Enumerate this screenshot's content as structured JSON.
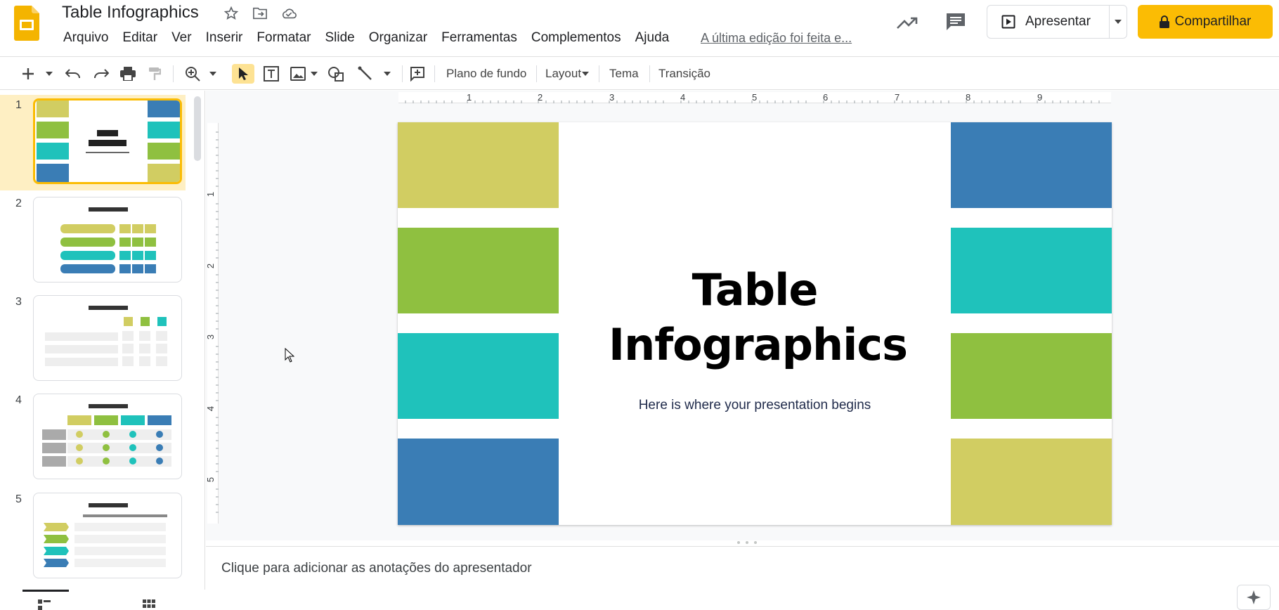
{
  "header": {
    "doc_title": "Table Infographics",
    "menu": [
      "Arquivo",
      "Editar",
      "Ver",
      "Inserir",
      "Formatar",
      "Slide",
      "Organizar",
      "Ferramentas",
      "Complementos",
      "Ajuda"
    ],
    "last_edit": "A última edição foi feita e...",
    "present_label": "Apresentar",
    "share_label": "Compartilhar"
  },
  "toolbar": {
    "background_label": "Plano de fundo",
    "layout_label": "Layout",
    "theme_label": "Tema",
    "transition_label": "Transição"
  },
  "filmstrip": {
    "slide_numbers": [
      "1",
      "2",
      "3",
      "4",
      "5"
    ],
    "selected": 1
  },
  "ruler": {
    "h_ticks": [
      "1",
      "2",
      "3",
      "4",
      "5",
      "6",
      "7",
      "8",
      "9"
    ],
    "v_ticks": [
      "1",
      "2",
      "3",
      "4",
      "5"
    ]
  },
  "slide": {
    "title_line1": "Table",
    "title_line2": "Infographics",
    "subtitle": "Here is where your presentation begins",
    "colors": {
      "olive": "#d1cd62",
      "green": "#8fc040",
      "teal": "#1fc2bb",
      "blue": "#3a7db5"
    }
  },
  "notes": {
    "placeholder": "Clique para adicionar as anotações do apresentador"
  },
  "colors": {
    "accent": "#fbbc04",
    "selected_bg": "#feefc3"
  }
}
